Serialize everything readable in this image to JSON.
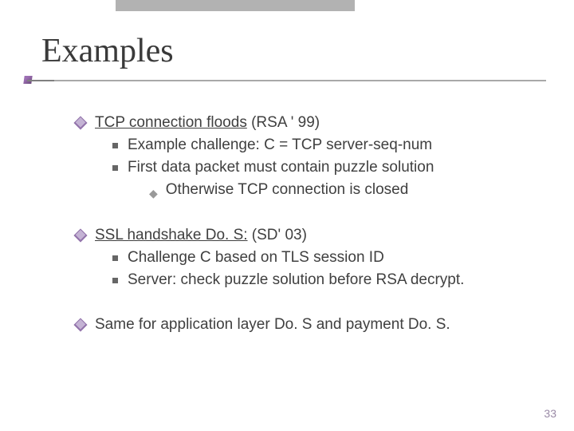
{
  "slide": {
    "title": "Examples",
    "page_number": "33"
  },
  "b1": {
    "title_u": "TCP connection floods",
    "title_rest": "  (RSA ' 99)",
    "s1": "Example challenge:     C = TCP server-seq-num",
    "s2": "First data packet must contain puzzle solution",
    "s2a": "Otherwise TCP connection is closed"
  },
  "b2": {
    "title_u": "SSL handshake Do. S:",
    "title_rest": "   (SD' 03)",
    "s1": "Challenge C based on TLS session ID",
    "s2": "Server:  check puzzle solution before RSA decrypt."
  },
  "b3": {
    "text": "Same for application layer Do. S and payment Do. S."
  }
}
